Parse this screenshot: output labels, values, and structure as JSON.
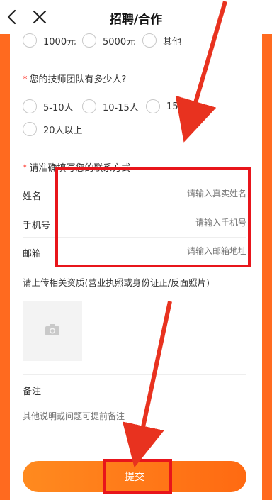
{
  "header": {
    "title": "招聘/合作",
    "back_icon": "chevron-left-icon",
    "close_icon": "close-icon"
  },
  "budget_options": [
    "1000元",
    "5000元",
    "其他"
  ],
  "team_size": {
    "question": "您的技师团队有多少人?",
    "required_mark": "*",
    "options": [
      "5-10人",
      "10-15人",
      "15-2",
      "20人以上"
    ]
  },
  "contact": {
    "question": "请准确填写您的联系方式",
    "required_mark": "*",
    "name_label": "姓名",
    "name_placeholder": "请输入真实姓名",
    "phone_label": "手机号",
    "phone_placeholder": "请输入手机号",
    "email_label": "邮箱",
    "email_placeholder": "请输入邮箱地址"
  },
  "upload": {
    "label": "请上传相关资质(营业执照或身份证正/反面照片)",
    "icon": "camera-icon"
  },
  "notes": {
    "label": "备注",
    "placeholder": "其他说明或问题可提前备注"
  },
  "submit_label": "提交",
  "colors": {
    "brand_orange": "#ff6a1f",
    "annotation_red": "#e8151b",
    "required_star": "#ff3b30"
  }
}
